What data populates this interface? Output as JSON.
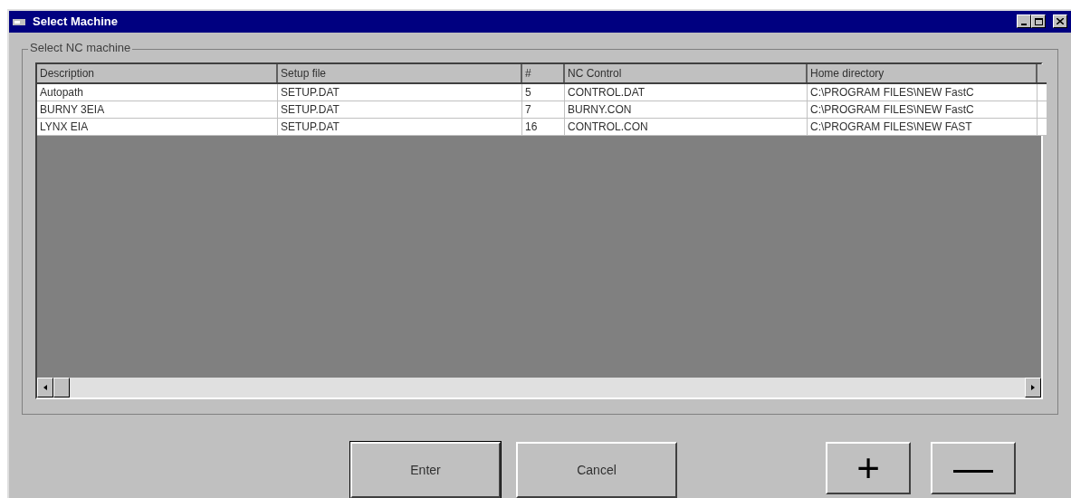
{
  "window": {
    "title": "Select Machine"
  },
  "group": {
    "label": "Select NC machine"
  },
  "table": {
    "columns": [
      "Description",
      "Setup file",
      "#",
      "NC Control",
      "Home directory"
    ],
    "rows": [
      [
        "Autopath",
        "SETUP.DAT",
        "5",
        "CONTROL.DAT",
        "C:\\PROGRAM FILES\\NEW FastC"
      ],
      [
        "BURNY 3EIA",
        "SETUP.DAT",
        "7",
        "BURNY.CON",
        "C:\\PROGRAM FILES\\NEW FastC"
      ],
      [
        "LYNX EIA",
        "SETUP.DAT",
        "16",
        "CONTROL.CON",
        "C:\\PROGRAM FILES\\NEW FAST"
      ]
    ]
  },
  "buttons": [
    {
      "label": "Enter",
      "kind": "default"
    },
    {
      "label": "Cancel",
      "kind": "normal"
    },
    {
      "label": "+",
      "kind": "icon"
    },
    {
      "label": "—",
      "kind": "icon"
    }
  ]
}
